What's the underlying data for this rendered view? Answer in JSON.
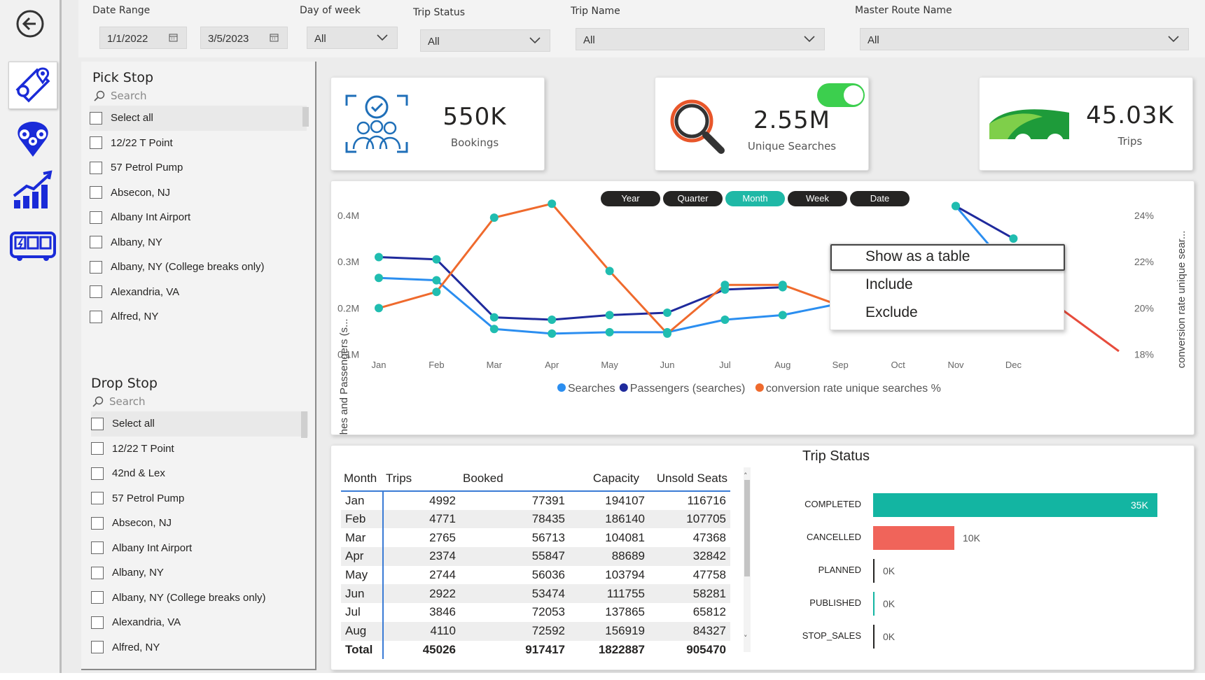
{
  "slicers": {
    "date_range": {
      "label": "Date Range",
      "start": "1/1/2022",
      "end": "3/5/2023"
    },
    "day_of_week": {
      "label": "Day of week",
      "value": "All"
    },
    "trip_status": {
      "label": "Trip Status",
      "value": "All"
    },
    "trip_name": {
      "label": "Trip Name",
      "value": "All"
    },
    "master_route": {
      "label": "Master Route Name",
      "value": "All"
    }
  },
  "nav": [
    "back-icon",
    "route-icon",
    "locations-icon",
    "growth-chart-icon",
    "bus-icon"
  ],
  "pick_stop": {
    "title": "Pick Stop",
    "search_placeholder": "Search",
    "items": [
      "Select all",
      "12/22 T Point",
      "57 Petrol Pump",
      "Absecon, NJ",
      "Albany Int Airport",
      "Albany, NY",
      "Albany, NY (College breaks only)",
      "Alexandria, VA",
      "Alfred, NY"
    ]
  },
  "drop_stop": {
    "title": "Drop Stop",
    "search_placeholder": "Search",
    "items": [
      "Select all",
      "12/22 T Point",
      "42nd & Lex",
      "57 Petrol Pump",
      "Absecon, NJ",
      "Albany Int Airport",
      "Albany, NY",
      "Albany, NY (College breaks only)",
      "Alexandria, VA",
      "Alfred, NY"
    ]
  },
  "kpis": {
    "bookings": {
      "value": "550K",
      "label": "Bookings",
      "icon": "customers-check-icon"
    },
    "searches": {
      "value": "2.55M",
      "label": "Unique Searches",
      "icon": "magnifier-icon",
      "toggle_on": true
    },
    "trips": {
      "value": "45.03K",
      "label": "Trips",
      "icon": "bus-wheels-icon"
    }
  },
  "time_buttons": [
    {
      "label": "Year",
      "active": false
    },
    {
      "label": "Quarter",
      "active": false
    },
    {
      "label": "Month",
      "active": true
    },
    {
      "label": "Week",
      "active": false
    },
    {
      "label": "Date",
      "active": false
    }
  ],
  "context_menu": {
    "items": [
      "Show as a table",
      "Include",
      "Exclude"
    ],
    "selected": 0
  },
  "chart_data": [
    {
      "type": "line",
      "title": "",
      "categories": [
        "Jan",
        "Feb",
        "Mar",
        "Apr",
        "May",
        "Jun",
        "Jul",
        "Aug",
        "Sep",
        "Oct",
        "Nov",
        "Dec"
      ],
      "ylabel": "Searches and Passengers (s...",
      "y2label": "conversion rate unique sear...",
      "y_ticks": [
        "0.1M",
        "0.2M",
        "0.3M",
        "0.4M"
      ],
      "y2_ticks": [
        "18%",
        "20%",
        "22%",
        "24%"
      ],
      "ylim": [
        0.1,
        0.4
      ],
      "y2lim": [
        18,
        24
      ],
      "legend_position": "bottom",
      "series": [
        {
          "name": "Searches",
          "axis": "left",
          "color": "#2b8ef0",
          "values": [
            0.265,
            0.26,
            0.155,
            0.145,
            0.148,
            0.148,
            0.175,
            0.185,
            0.21,
            null,
            0.42,
            0.275
          ]
        },
        {
          "name": "Passengers (searches)",
          "axis": "left",
          "color": "#1f2a9c",
          "values": [
            0.31,
            0.305,
            0.18,
            0.175,
            0.185,
            0.19,
            0.24,
            0.245,
            null,
            null,
            0.42,
            0.35
          ]
        },
        {
          "name": "conversion rate unique searches %",
          "axis": "right",
          "color": "#ef6a2d",
          "values": [
            20.0,
            20.7,
            23.9,
            24.5,
            21.6,
            18.9,
            21.0,
            21.0,
            20.1,
            null,
            null,
            21.8
          ]
        }
      ]
    },
    {
      "type": "bar",
      "title": "Trip Status",
      "orientation": "horizontal",
      "categories": [
        "COMPLETED",
        "CANCELLED",
        "PLANNED",
        "PUBLISHED",
        "STOP_SALES"
      ],
      "values": [
        35,
        10,
        0,
        0,
        0
      ],
      "value_labels": [
        "35K",
        "10K",
        "0K",
        "0K",
        "0K"
      ],
      "colors": [
        "#13b5a2",
        "#f0645a",
        "#252423",
        "#13b5a2",
        "#252423"
      ],
      "xlim": [
        0,
        35
      ]
    }
  ],
  "table": {
    "headers": [
      "Month",
      "Trips",
      "Booked",
      "Capacity",
      "Unsold Seats"
    ],
    "rows": [
      [
        "Jan",
        "4992",
        "77391",
        "194107",
        "116716"
      ],
      [
        "Feb",
        "4771",
        "78435",
        "186140",
        "107705"
      ],
      [
        "Mar",
        "2765",
        "56713",
        "104081",
        "47368"
      ],
      [
        "Apr",
        "2374",
        "55847",
        "88689",
        "32842"
      ],
      [
        "May",
        "2744",
        "56036",
        "103794",
        "47758"
      ],
      [
        "Jun",
        "2922",
        "53474",
        "111755",
        "58281"
      ],
      [
        "Jul",
        "3846",
        "72053",
        "137865",
        "65812"
      ],
      [
        "Aug",
        "4110",
        "72592",
        "156919",
        "84327"
      ]
    ],
    "total": [
      "Total",
      "45026",
      "917417",
      "1822887",
      "905470"
    ]
  }
}
